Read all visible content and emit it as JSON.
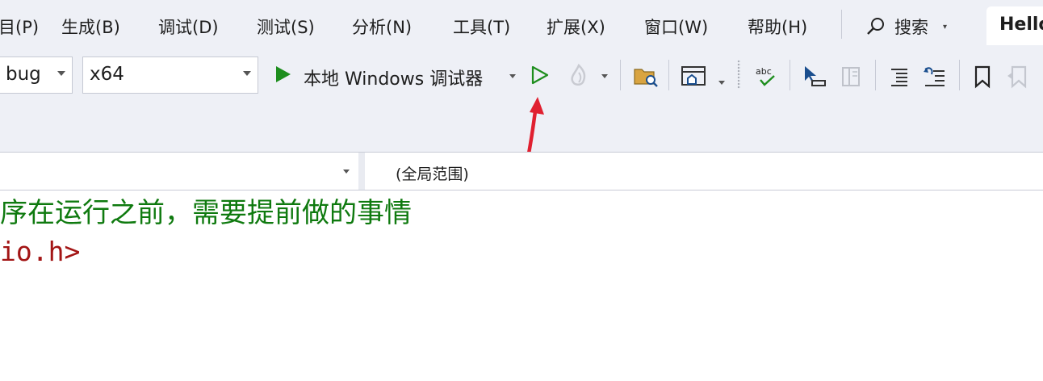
{
  "menu": {
    "items": [
      "目(P)",
      "生成(B)",
      "调试(D)",
      "测试(S)",
      "分析(N)",
      "工具(T)",
      "扩展(X)",
      "窗口(W)",
      "帮助(H)"
    ],
    "search_label": "搜索",
    "window_title": "Hello"
  },
  "toolbar": {
    "config_value": "bug",
    "platform_value": "x64",
    "debugger_label": "本地 Windows 调试器"
  },
  "scope": {
    "left_value": "",
    "right_value": "(全局范围)"
  },
  "code": {
    "comment_line": "序在运行之前，需要提前做的事情",
    "include_line": "io.h>"
  },
  "colors": {
    "accent_green": "#1e8e1e",
    "arrow_red": "#e02030",
    "comment_green": "#0f7a0f",
    "include_red": "#a31515"
  }
}
